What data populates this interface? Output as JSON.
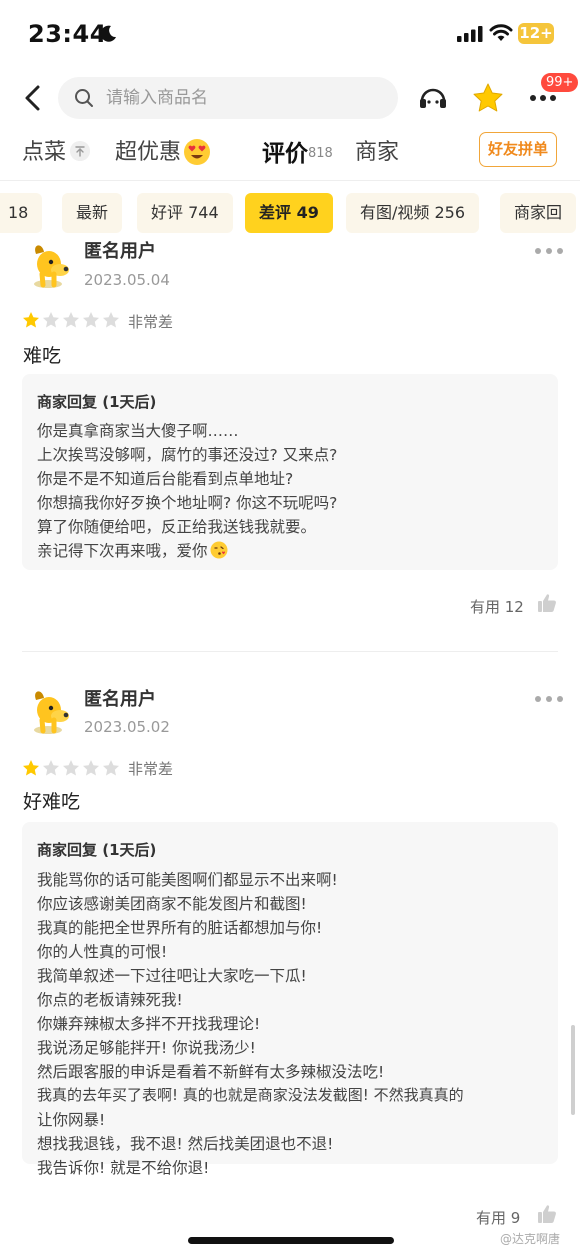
{
  "status_bar": {
    "time": "23:44",
    "battery": "12+"
  },
  "search": {
    "placeholder": "请输入商品名"
  },
  "header": {
    "badge": "99+"
  },
  "tabs": [
    {
      "label": "点菜"
    },
    {
      "label": "超优惠"
    },
    {
      "label": "评价",
      "count": "818"
    },
    {
      "label": "商家"
    }
  ],
  "group_button": "好友拼单",
  "chips": [
    {
      "label": "18"
    },
    {
      "label": "最新"
    },
    {
      "label": "好评 744"
    },
    {
      "label": "差评 49",
      "active": true
    },
    {
      "label": "有图/视频 256"
    },
    {
      "label": "商家回"
    }
  ],
  "reviews": [
    {
      "user": "匿名用户",
      "date": "2023.05.04",
      "rating": 1,
      "rating_label": "非常差",
      "text": "难吃",
      "reply_title": "商家回复 (1天后)",
      "reply_lines": [
        "你是真拿商家当大傻子啊……",
        "上次挨骂没够啊，腐竹的事还没过? 又来点?",
        "你是不是不知道后台能看到点单地址?",
        "你想搞我你好歹换个地址啊? 你这不玩呢吗?",
        "算了你随便给吧，反正给我送钱我就要。",
        "亲记得下次再来哦，爱你"
      ],
      "useful": "有用 12"
    },
    {
      "user": "匿名用户",
      "date": "2023.05.02",
      "rating": 1,
      "rating_label": "非常差",
      "text": "好难吃",
      "reply_title": "商家回复 (1天后)",
      "reply_lines": [
        "我能骂你的话可能美图啊们都显示不出来啊!",
        "你应该感谢美团商家不能发图片和截图!",
        "我真的能把全世界所有的脏话都想加与你!",
        "你的人性真的可恨!",
        "我简单叙述一下过往吧让大家吃一下瓜!",
        "你点的老板请辣死我!",
        "你嫌弃辣椒太多拌不开找我理论!",
        "我说汤足够能拌开! 你说我汤少!",
        "然后跟客服的申诉是看着不新鲜有太多辣椒没法吃!",
        "我真的去年买了表啊! 真的也就是商家没法发截图! 不然我真真的",
        "让你网暴!",
        "想找我退钱，我不退! 然后找美团退也不退!",
        "我告诉你! 就是不给你退!"
      ],
      "useful": "有用 9"
    }
  ],
  "watermark": "@达克啊唐",
  "colors": {
    "accent_yellow": "#ffd21e",
    "star_on": "#ffc900",
    "star_off": "#dddddd",
    "badge_red": "#ff4a3d",
    "orange": "#f08a1d"
  }
}
